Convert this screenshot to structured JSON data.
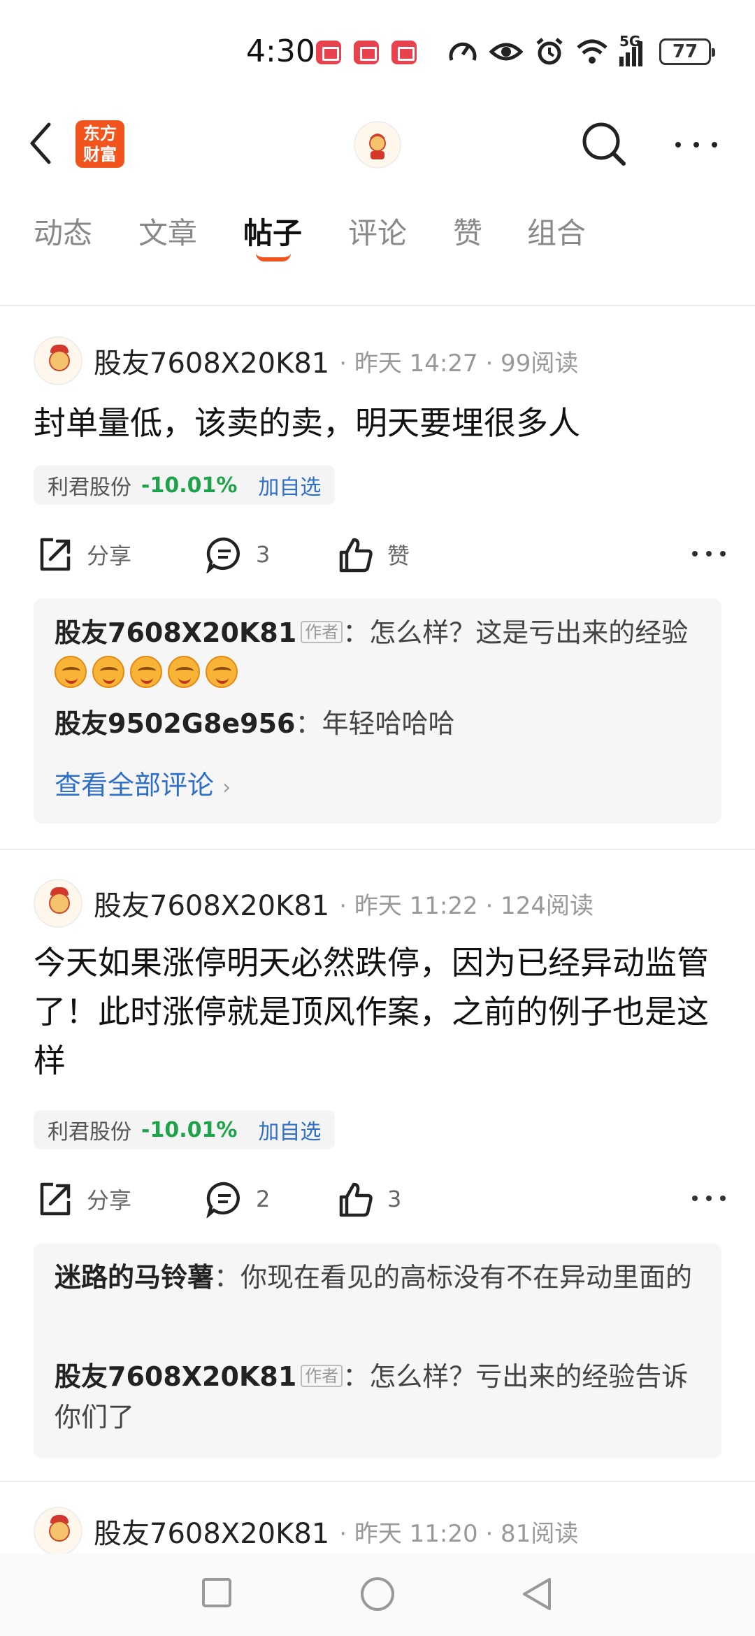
{
  "status_bar": {
    "time": "4:30",
    "network": "5G",
    "battery": "77",
    "icons": [
      "huawei-app-icon",
      "book-app-icon",
      "book-app-icon",
      "speed-icon",
      "eye-icon",
      "alarm-icon",
      "wifi-icon",
      "signal-icon",
      "battery-icon"
    ]
  },
  "header": {
    "logo_line1": "东方",
    "logo_line2": "财富",
    "accent_color": "#f2541d"
  },
  "tabs": [
    {
      "label": "动态"
    },
    {
      "label": "文章"
    },
    {
      "label": "帖子",
      "active": true
    },
    {
      "label": "评论"
    },
    {
      "label": "赞"
    },
    {
      "label": "组合"
    }
  ],
  "posts": [
    {
      "author": "股友7608X20K81",
      "meta": "· 昨天 14:27 · 99阅读",
      "title": "封单量低，该卖的卖，明天要埋很多人",
      "stock": {
        "name": "利君股份",
        "change": "-10.01%",
        "add": "加自选"
      },
      "actions": {
        "share": "分享",
        "comments": "3",
        "like": "赞"
      },
      "comments": [
        {
          "author": "股友7608X20K81",
          "tag": "作者",
          "text": "：怎么样？这是亏出来的经验"
        },
        {
          "author": "股友9502G8e956",
          "text": "：年轻哈哈哈"
        }
      ],
      "view_all": "查看全部评论"
    },
    {
      "author": "股友7608X20K81",
      "meta": "· 昨天 11:22 · 124阅读",
      "title": "今天如果涨停明天必然跌停，因为已经异动监管了！此时涨停就是顶风作案，之前的例子也是这样",
      "stock": {
        "name": "利君股份",
        "change": "-10.01%",
        "add": "加自选"
      },
      "actions": {
        "share": "分享",
        "comments": "2",
        "like": "3"
      },
      "comments": [
        {
          "author": "迷路的马铃薯",
          "text": "：你现在看见的高标没有不在异动里面的"
        },
        {
          "author": "股友7608X20K81",
          "tag": "作者",
          "text": "：怎么样？亏出来的经验告诉你们了"
        }
      ]
    },
    {
      "author": "股友7608X20K81",
      "meta": "· 昨天 11:20 · 81阅读"
    }
  ],
  "colors": {
    "down": "#1fa34a",
    "link": "#2f6fc8",
    "tab_underline": "#f0541e"
  }
}
